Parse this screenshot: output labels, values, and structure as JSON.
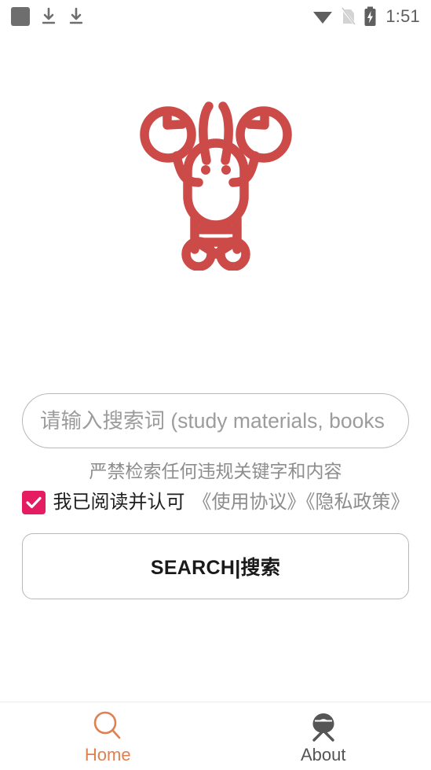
{
  "status_bar": {
    "left_icons": [
      "app-square-icon",
      "download-icon",
      "download-icon"
    ],
    "right_icons": [
      "wifi-icon",
      "no-sim-icon",
      "battery-charging-icon"
    ],
    "time": "1:51"
  },
  "logo": {
    "icon_name": "lobster-logo",
    "color": "#cc4a47"
  },
  "search": {
    "placeholder": "请输入搜索词 (study materials, books",
    "value": ""
  },
  "notice": {
    "warning": "严禁检索任何违规关键字和内容"
  },
  "agreement": {
    "checked": true,
    "checkbox_color": "#e51c62",
    "label": "我已阅读并认可",
    "links": "《使用协议》《隐私政策》"
  },
  "actions": {
    "search_label": "SEARCH|搜索"
  },
  "bottom_nav": {
    "items": [
      {
        "label": "Home",
        "icon": "search-icon",
        "active": true,
        "color": "#e08050"
      },
      {
        "label": "About",
        "icon": "lobster-head-icon",
        "active": false,
        "color": "#555555"
      }
    ]
  }
}
